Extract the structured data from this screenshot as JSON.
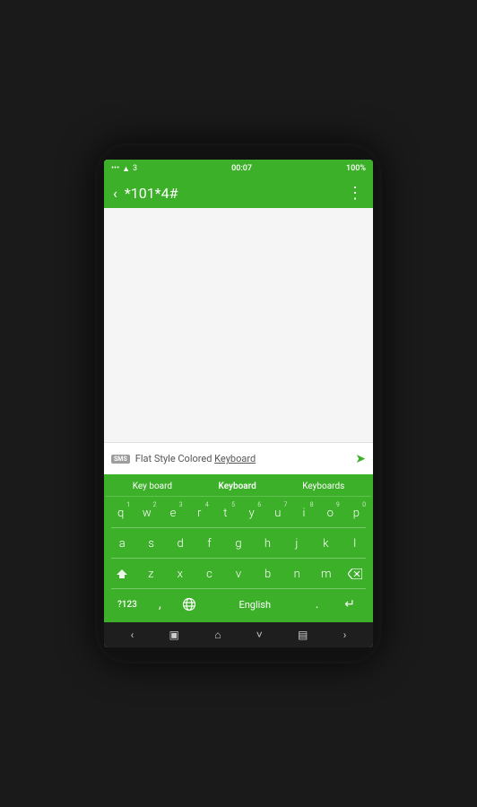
{
  "status": {
    "signal": "•••",
    "wifi": "WiFi",
    "sim": "3",
    "time": "00:07",
    "battery": "100%"
  },
  "titlebar": {
    "back_icon": "‹",
    "title": "*101*4#",
    "menu_icon": "⋮"
  },
  "input": {
    "sms_label": "SMS",
    "placeholder": "Flat Style Colored Keyboard",
    "placeholder_underline": "Keyboard",
    "send_icon": "➤"
  },
  "suggestions": [
    {
      "label": "Key board",
      "id": 0
    },
    {
      "label": "Keyboard",
      "id": 1,
      "active": true
    },
    {
      "label": "Keyboards",
      "id": 2
    }
  ],
  "keyboard": {
    "row1": [
      {
        "char": "q",
        "num": "1"
      },
      {
        "char": "w",
        "num": "2"
      },
      {
        "char": "e",
        "num": "3"
      },
      {
        "char": "r",
        "num": "4"
      },
      {
        "char": "t",
        "num": "5"
      },
      {
        "char": "y",
        "num": "6"
      },
      {
        "char": "u",
        "num": "7"
      },
      {
        "char": "i",
        "num": "8"
      },
      {
        "char": "o",
        "num": "9"
      },
      {
        "char": "p",
        "num": "0"
      }
    ],
    "row2": [
      {
        "char": "a"
      },
      {
        "char": "s"
      },
      {
        "char": "d"
      },
      {
        "char": "f"
      },
      {
        "char": "g"
      },
      {
        "char": "h"
      },
      {
        "char": "j"
      },
      {
        "char": "k"
      },
      {
        "char": "l"
      }
    ],
    "row3": [
      {
        "char": "z"
      },
      {
        "char": "x"
      },
      {
        "char": "c"
      },
      {
        "char": "v"
      },
      {
        "char": "b"
      },
      {
        "char": "n"
      },
      {
        "char": "m"
      }
    ],
    "bottom": {
      "num_toggle": "?123",
      "comma": ",",
      "globe": "🌐",
      "space": "English",
      "period": ".",
      "enter": "↵"
    }
  },
  "navbar": {
    "back": "‹",
    "recents": "▣",
    "home": "⌂",
    "down": "˅",
    "menu": "▤",
    "forward": "›"
  },
  "colors": {
    "green": "#3cb028",
    "dark_green": "#35a022",
    "white": "#ffffff",
    "nav_bg": "#1e1e1e"
  }
}
